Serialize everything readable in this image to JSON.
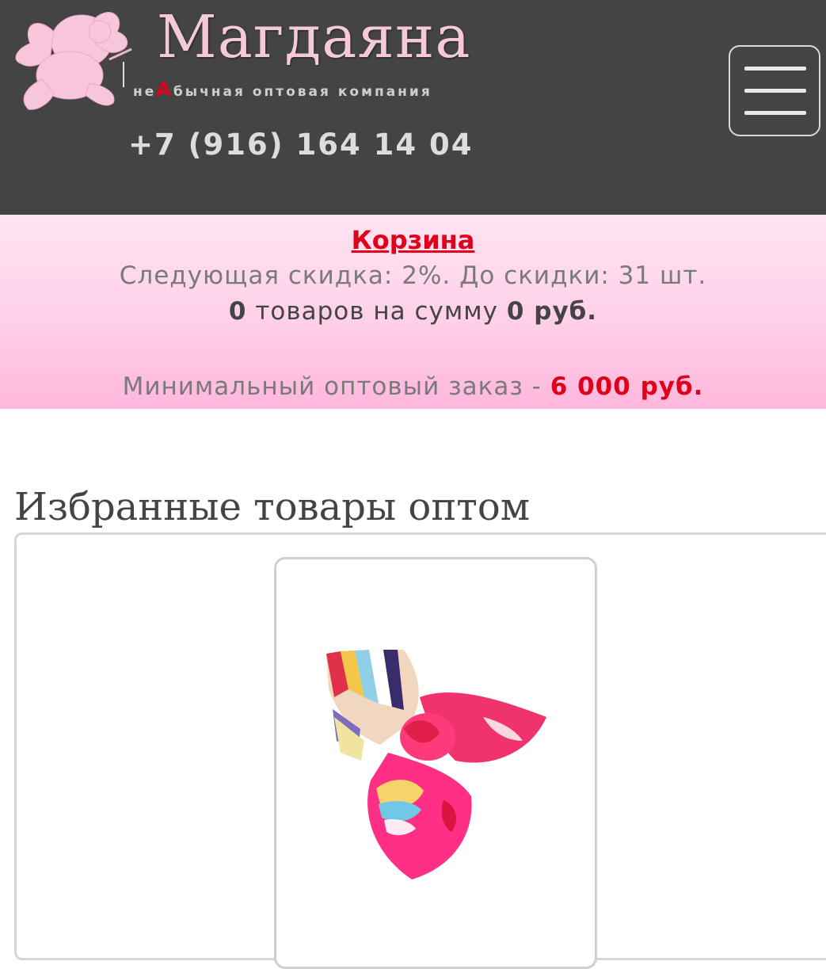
{
  "header": {
    "brand_name": "Магдаяна",
    "tagline_prefix": "не",
    "tagline_accent": "А",
    "tagline_suffix": "бычная оптовая компания",
    "phone": "+7 (916) 164 14 04",
    "logo_icon": "cupid-logo-icon",
    "menu_icon": "hamburger-menu-icon"
  },
  "cart": {
    "link_label": "Корзина",
    "discount_text": "Следующая скидка: 2%. До скидки: 31 шт.",
    "items_count": "0",
    "items_mid": " товаров на сумму ",
    "sum": "0 руб.",
    "min_order_label": "Минимальный оптовый заказ - ",
    "min_order_value": "6 000 руб."
  },
  "featured": {
    "title": "Избранные товары оптом",
    "products": [
      {
        "image_icon": "silk-scarf-image"
      }
    ]
  },
  "colors": {
    "header_bg": "#444444",
    "accent_red": "#e0001a",
    "brand_pink": "#f5c9dc",
    "cart_gradient_top": "#ffe4f2",
    "cart_gradient_bottom": "#ffb7dc"
  }
}
